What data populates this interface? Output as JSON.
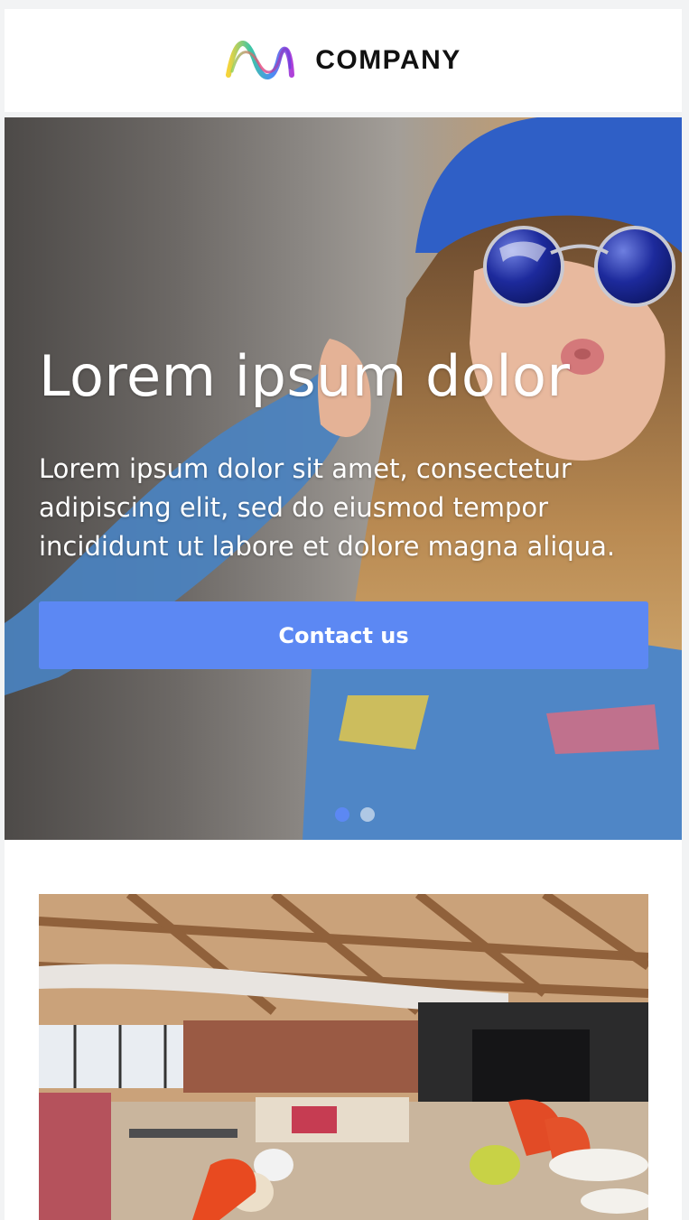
{
  "header": {
    "brand": "COMPANY",
    "logo_icon": "wave-logo-icon"
  },
  "hero": {
    "title": "Lorem ipsum dolor",
    "body": "Lorem ipsum dolor sit amet, consectetur adipiscing elit, sed do eiusmod tempor incididunt ut labore et dolore magna aliqua.",
    "cta_label": "Contact us",
    "carousel": {
      "slides": 2,
      "active_index": 0
    }
  },
  "colors": {
    "accent": "#5c88f3",
    "page_bg": "#f2f3f4",
    "brand_text": "#111111"
  }
}
